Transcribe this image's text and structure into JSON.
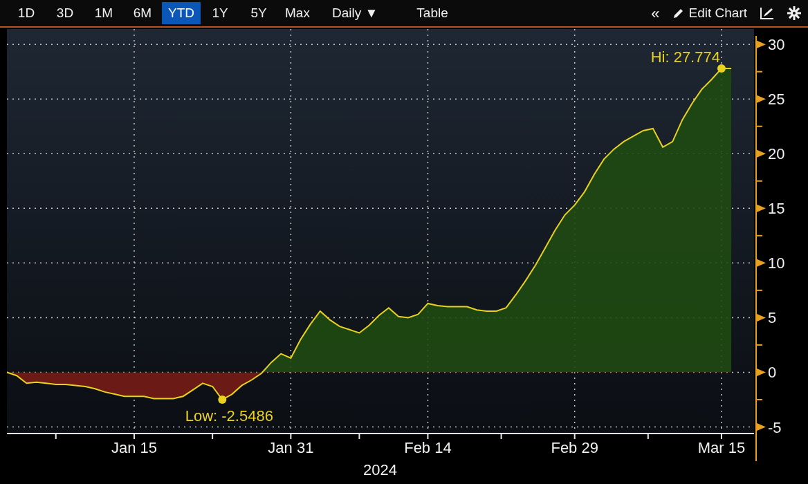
{
  "toolbar": {
    "periods": [
      {
        "label": "1D",
        "selected": false
      },
      {
        "label": "3D",
        "selected": false
      },
      {
        "label": "1M",
        "selected": false
      },
      {
        "label": "6M",
        "selected": false
      },
      {
        "label": "YTD",
        "selected": true
      },
      {
        "label": "1Y",
        "selected": false
      },
      {
        "label": "5Y",
        "selected": false
      },
      {
        "label": "Max",
        "selected": false
      }
    ],
    "frequency": "Daily ▼",
    "table_button": "Table",
    "collapse": "«",
    "edit_chart": "Edit Chart"
  },
  "chart": {
    "chart_data": {
      "type": "area",
      "categories": [
        null,
        null,
        null,
        null,
        null,
        null,
        null,
        null,
        null,
        null,
        null,
        null,
        null,
        "Jan 15",
        null,
        null,
        null,
        null,
        null,
        null,
        null,
        null,
        null,
        null,
        null,
        null,
        null,
        null,
        null,
        "Jan 31",
        null,
        null,
        null,
        null,
        null,
        null,
        null,
        null,
        null,
        null,
        null,
        null,
        null,
        "Feb 14",
        null,
        null,
        null,
        null,
        null,
        null,
        null,
        null,
        null,
        null,
        null,
        null,
        null,
        null,
        "Feb 29",
        null,
        null,
        null,
        null,
        null,
        null,
        null,
        null,
        null,
        null,
        null,
        null,
        null,
        null,
        "Mar 15",
        null
      ],
      "series": [
        {
          "color": "#e8d21d",
          "values": [
            0,
            -0.3,
            -1.0,
            -0.9,
            -1.0,
            -1.1,
            -1.1,
            -1.2,
            -1.3,
            -1.5,
            -1.8,
            -2.0,
            -2.2,
            -2.2,
            -2.2,
            -2.4,
            -2.4,
            -2.4,
            -2.2,
            -1.6,
            -1.0,
            -1.3,
            -2.5,
            -2.0,
            -1.2,
            -0.7,
            -0.1,
            0.9,
            1.7,
            1.3,
            3.0,
            4.4,
            5.6,
            4.8,
            4.2,
            3.9,
            3.6,
            4.3,
            5.2,
            5.9,
            5.1,
            5.0,
            5.3,
            6.3,
            6.1,
            6.0,
            6.0,
            6.0,
            5.7,
            5.6,
            5.6,
            5.9,
            7.1,
            8.4,
            9.8,
            11.4,
            13.0,
            14.4,
            15.3,
            16.5,
            18.1,
            19.5,
            20.4,
            21.1,
            21.6,
            22.1,
            22.3,
            20.6,
            21.1,
            23.1,
            24.6,
            25.9,
            26.8,
            27.8,
            27.8
          ]
        }
      ],
      "ylim": [
        -5.6,
        31.4
      ],
      "yticks": [
        -5,
        0,
        5,
        10,
        15,
        20,
        25,
        30
      ],
      "xlabel": "2024",
      "grid": true,
      "annotations": [
        "Low: -2.5486",
        "Hi: 27.774"
      ]
    }
  }
}
